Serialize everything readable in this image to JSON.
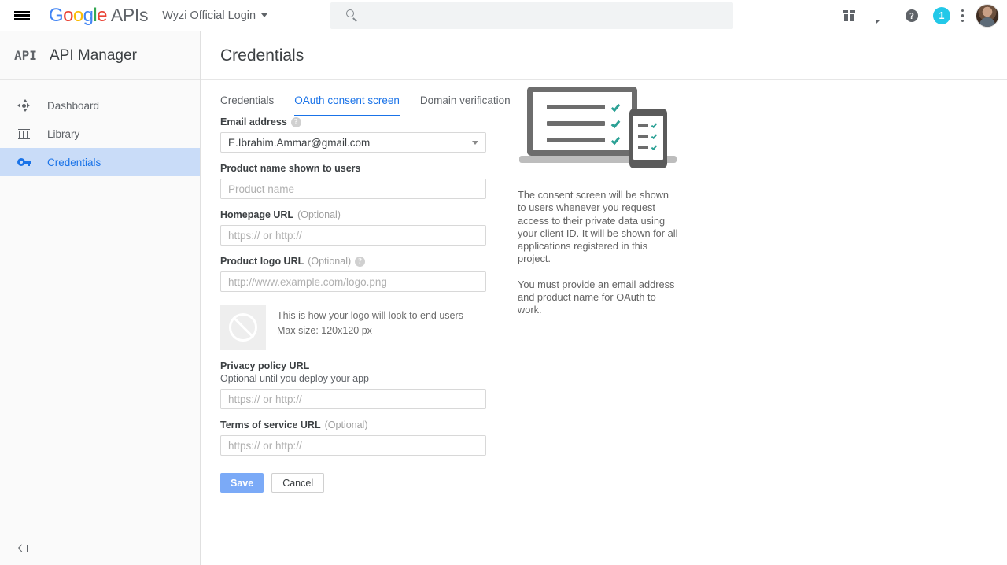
{
  "topbar": {
    "menu_icon": "hamburger-menu-icon",
    "logo_text": "Google",
    "logo_suffix": "APIs",
    "project_name": "Wyzi Official Login",
    "search_placeholder": "",
    "search_value": "",
    "search_icon": "search-icon",
    "actions": [
      {
        "name": "gift-icon",
        "label": ""
      },
      {
        "name": "notifications-icon",
        "label": ""
      },
      {
        "name": "help-icon",
        "label": "?"
      }
    ],
    "badge_count": "1",
    "badge_color": "#23c8e8",
    "kebab_icon": "more-vert-icon",
    "avatar": "user-avatar"
  },
  "sidebar": {
    "logo_badge": "API",
    "title": "API Manager",
    "items": [
      {
        "label": "Dashboard",
        "icon": "dashboard-icon",
        "selected": false
      },
      {
        "label": "Library",
        "icon": "library-icon",
        "selected": false
      },
      {
        "label": "Credentials",
        "icon": "key-icon",
        "selected": true
      }
    ],
    "collapse_icon": "collapse-sidebar-icon",
    "selected_bg": "#c9dcf8",
    "selected_fg": "#1a73e8"
  },
  "page": {
    "title": "Credentials",
    "tabs": [
      {
        "label": "Credentials",
        "active": false
      },
      {
        "label": "OAuth consent screen",
        "active": true
      },
      {
        "label": "Domain verification",
        "active": false
      }
    ]
  },
  "form": {
    "email": {
      "label": "Email address",
      "help_icon": "help-circle-icon",
      "value": "E.Ibrahim.Ammar@gmail.com",
      "caret_icon": "chevron-down-icon"
    },
    "product_name": {
      "label": "Product name shown to users",
      "placeholder": "Product name",
      "value": ""
    },
    "homepage_url": {
      "label": "Homepage URL",
      "optional": "(Optional)",
      "placeholder": "https:// or http://",
      "value": ""
    },
    "product_logo_url": {
      "label": "Product logo URL",
      "optional": "(Optional)",
      "help_icon": "help-circle-icon",
      "placeholder": "http://www.example.com/logo.png",
      "value": ""
    },
    "logo_preview": {
      "icon": "no-image-icon",
      "note_line1": "This is how your logo will look to end users",
      "note_line2": "Max size: 120x120 px"
    },
    "privacy_policy_url": {
      "label": "Privacy policy URL",
      "sub_label": "Optional until you deploy your app",
      "placeholder": "https:// or http://",
      "value": ""
    },
    "terms_of_service_url": {
      "label": "Terms of service URL",
      "optional": "(Optional)",
      "placeholder": "https:// or http://",
      "value": ""
    },
    "save_label": "Save",
    "cancel_label": "Cancel",
    "save_color": "#7baaf7"
  },
  "info": {
    "illustration": "devices-checklist-illustration",
    "paragraph1": "The consent screen will be shown to users whenever you request access to their private data using your client ID. It will be shown for all applications registered in this project.",
    "paragraph2": "You must provide an email address and product name for OAuth to work.",
    "accent_check_color": "#2ba195"
  }
}
